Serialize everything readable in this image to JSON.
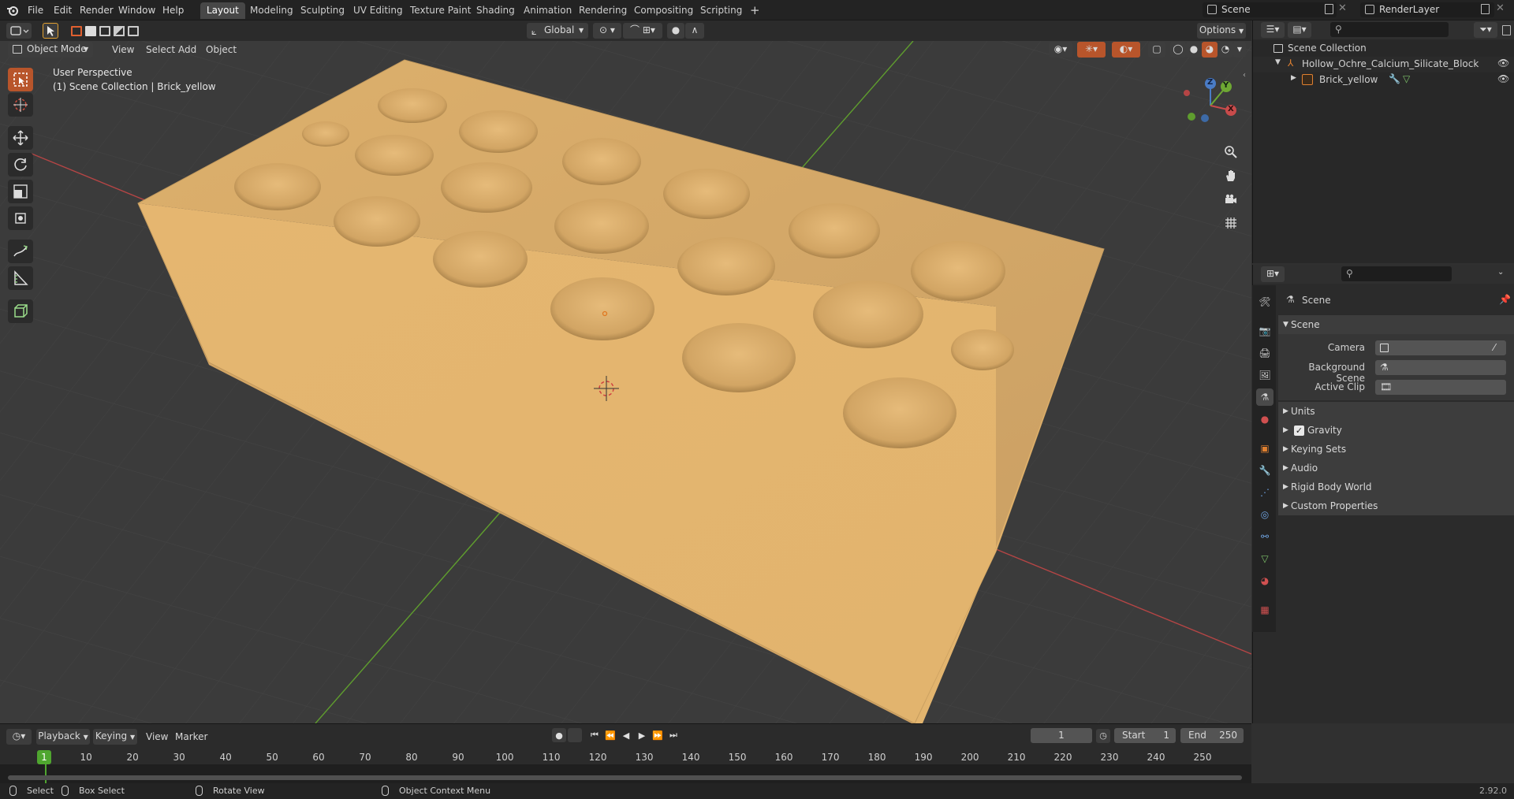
{
  "topbar": {
    "menus": [
      "File",
      "Edit",
      "Render",
      "Window",
      "Help"
    ],
    "workspaces": [
      "Layout",
      "Modeling",
      "Sculpting",
      "UV Editing",
      "Texture Paint",
      "Shading",
      "Animation",
      "Rendering",
      "Compositing",
      "Scripting"
    ],
    "active_workspace": "Layout",
    "add_tab": "+",
    "scene_name": "Scene",
    "render_layer": "RenderLayer"
  },
  "viewport_header": {
    "mode": "Object Mode",
    "menus": [
      "View",
      "Select",
      "Add",
      "Object"
    ],
    "transform_orientation": "Global",
    "options": "Options"
  },
  "viewport": {
    "perspective_label": "User Perspective",
    "collection_label": "(1) Scene Collection | Brick_yellow",
    "gizmo_axes": [
      "Z",
      "Y",
      "X"
    ]
  },
  "outliner": {
    "search_placeholder": "",
    "root": "Scene Collection",
    "collection": "Hollow_Ochre_Calcium_Silicate_Block",
    "object": "Brick_yellow"
  },
  "properties": {
    "context": "Scene",
    "panel_title": "Scene",
    "fields": [
      {
        "label": "Camera",
        "value": ""
      },
      {
        "label": "Background Scene",
        "value": ""
      },
      {
        "label": "Active Clip",
        "value": ""
      }
    ],
    "subpanels": [
      "Units",
      "Gravity",
      "Keying Sets",
      "Audio",
      "Rigid Body World",
      "Custom Properties"
    ],
    "gravity_checked": true
  },
  "timeline": {
    "menus": [
      "Playback",
      "Keying",
      "View",
      "Marker"
    ],
    "current_frame": "1",
    "start_label": "Start",
    "start": "1",
    "end_label": "End",
    "end": "250",
    "ticks": [
      "10",
      "20",
      "30",
      "40",
      "50",
      "60",
      "70",
      "80",
      "90",
      "100",
      "110",
      "120",
      "130",
      "140",
      "150",
      "160",
      "170",
      "180",
      "190",
      "200",
      "210",
      "220",
      "230",
      "240",
      "250"
    ],
    "playhead": "1"
  },
  "statusbar": {
    "select": "Select",
    "box_select": "Box Select",
    "rotate_view": "Rotate View",
    "context_menu": "Object Context Menu",
    "version": "2.92.0"
  },
  "colors": {
    "accent": "#b8552b",
    "brick": "#e3b56f",
    "x_axis": "#c84b4b",
    "y_axis": "#6ea833",
    "z_axis": "#4a7cc6"
  }
}
